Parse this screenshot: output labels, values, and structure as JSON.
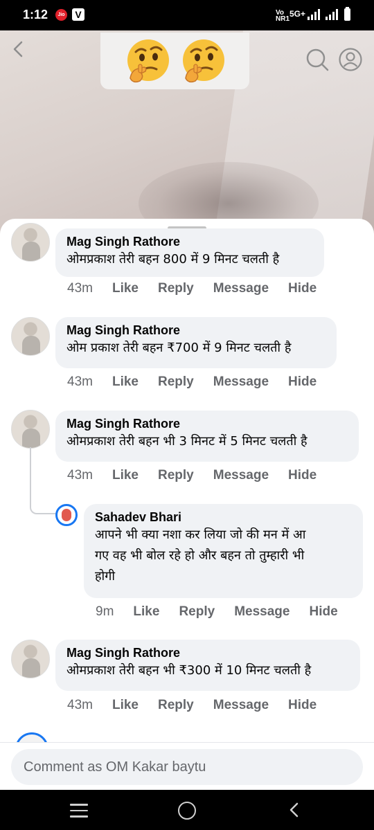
{
  "status_bar": {
    "time": "1:12",
    "jio_label": "Jio",
    "v_label": "V",
    "network_label_top": "Vo",
    "network_label_bottom": "NR1",
    "network_type": "5G+"
  },
  "header": {
    "icons": [
      "back-icon",
      "thinking-face-emoji",
      "thinking-face-emoji",
      "search-icon",
      "profile-icon"
    ]
  },
  "comments": [
    {
      "author": "Mag Singh Rathore",
      "text": "ओमप्रकाश तेरी बहन 800 में 9 मिनट चलती है",
      "time": "43m",
      "like": "Like",
      "reply": "Reply",
      "message": "Message",
      "hide": "Hide"
    },
    {
      "author": "Mag Singh Rathore",
      "text": "ओम प्रकाश तेरी बहन ₹700 में 9 मिनट चलती है",
      "time": "43m",
      "like": "Like",
      "reply": "Reply",
      "message": "Message",
      "hide": "Hide"
    },
    {
      "author": "Mag Singh Rathore",
      "text": "ओमप्रकाश तेरी बहन भी 3 मिनट में 5 मिनट चलती है",
      "time": "43m",
      "like": "Like",
      "reply": "Reply",
      "message": "Message",
      "hide": "Hide",
      "reply_comment": {
        "author": "Sahadev Bhari",
        "text_line1": "आपने भी क्या नशा कर लिया जो की मन में आ",
        "text_line2": "गए वह भी बोल रहे हो और बहन तो तुम्हारी भी",
        "text_line3": "होगी",
        "time": "9m",
        "like": "Like",
        "reply": "Reply",
        "message": "Message",
        "hide": "Hide"
      }
    },
    {
      "author": "Mag Singh Rathore",
      "text": "ओमप्रकाश तेरी बहन भी ₹300 में 10 मिनट चलती है",
      "time": "43m",
      "like": "Like",
      "reply": "Reply",
      "message": "Message",
      "hide": "Hide"
    }
  ],
  "composer": {
    "placeholder": "Comment as OM Kakar baytu"
  },
  "nav_bar": {
    "icons": [
      "recent-apps-icon",
      "home-icon",
      "back-icon"
    ]
  },
  "colors": {
    "accent": "#1877f2",
    "bubble": "#f0f2f5",
    "secondary_text": "#65676b"
  }
}
